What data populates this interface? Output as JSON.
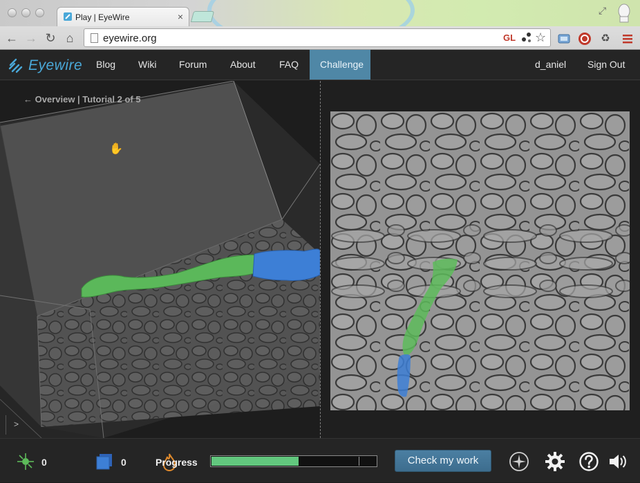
{
  "browser": {
    "tab_title": "Play | EyeWire",
    "tab_close": "×",
    "url": "eyewire.org",
    "gl_badge": "GL"
  },
  "nav": {
    "logo_text": "Eyewire",
    "links": [
      "Blog",
      "Wiki",
      "Forum",
      "About",
      "FAQ",
      "Challenge"
    ],
    "active_link": "Challenge",
    "username": "d_aniel",
    "sign_out": "Sign Out"
  },
  "main": {
    "breadcrumb": "← Overview | Tutorial 2 of 5",
    "console_prompt": ">"
  },
  "bottom": {
    "cubes_count": "0",
    "points_count": "0",
    "progress_label": "Progress",
    "progress_fraction": 0.53,
    "progress_marker_fraction": 0.895,
    "check_button": "Check my work"
  },
  "icons": {
    "neuron": "neuron-icon",
    "cube": "cube-icon",
    "flame": "flame-icon",
    "compass": "compass-icon",
    "settings": "gear-icon",
    "help": "help-icon",
    "sound": "speaker-icon"
  },
  "colors": {
    "accent": "#4aa8d8",
    "active_nav": "#4f87a6",
    "progress_fill": "#62c77e",
    "segment_green": "#5dbb5a",
    "segment_blue": "#3d7fd6"
  }
}
